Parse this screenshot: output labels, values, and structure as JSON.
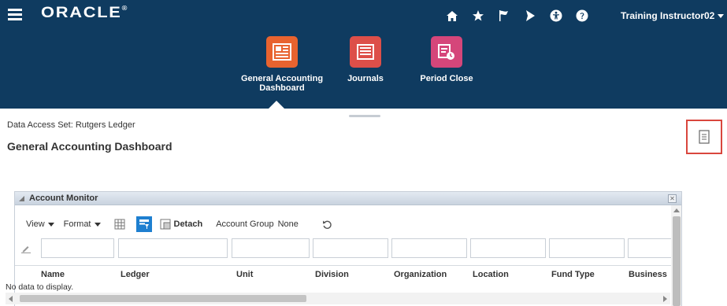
{
  "header": {
    "logo": "ORACLE",
    "logo_mark": "®",
    "user_name": "Training Instructor02",
    "icons": [
      "home-icon",
      "favorites-star-icon",
      "flag-icon",
      "bell-icon",
      "accessibility-icon",
      "help-icon"
    ]
  },
  "apps": [
    {
      "label": "General Accounting Dashboard",
      "color": "#e8632f",
      "selected": true
    },
    {
      "label": "Journals",
      "color": "#dd4f49"
    },
    {
      "label": "Period Close",
      "color": "#d5467a"
    }
  ],
  "page": {
    "data_access_set": "Data Access Set: Rutgers Ledger",
    "title": "General Accounting Dashboard"
  },
  "panel": {
    "title": "Account Monitor",
    "toolbar": {
      "view_label": "View",
      "format_label": "Format",
      "detach_label": "Detach",
      "account_group_label": "Account Group",
      "account_group_value": "None"
    },
    "columns": [
      "Name",
      "Ledger",
      "Unit",
      "Division",
      "Organization",
      "Location",
      "Fund Type",
      "Business"
    ],
    "empty_message": "No data to display."
  },
  "colors": {
    "header_bg": "#0f3b60",
    "highlight_border": "#d9463d",
    "accent_blue": "#1e7fd0"
  }
}
